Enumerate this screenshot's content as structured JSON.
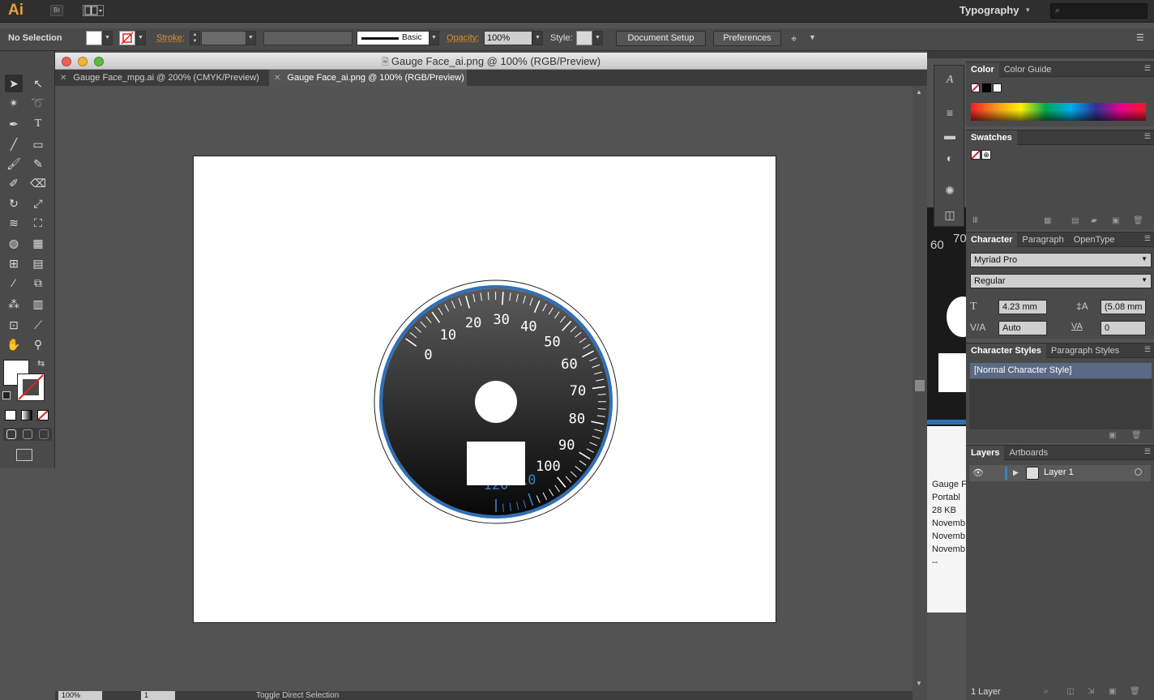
{
  "app": {
    "logo": "Ai",
    "bridge": "Br",
    "workspace": "Typography"
  },
  "control": {
    "selection": "No Selection",
    "stroke_label": "Stroke:",
    "brush": "Basic",
    "opacity_label": "Opacity:",
    "opacity_value": "100%",
    "style_label": "Style:",
    "document_setup": "Document Setup",
    "preferences": "Preferences"
  },
  "document": {
    "title": "Gauge Face_ai.png @ 100% (RGB/Preview)",
    "tabs": [
      {
        "label": "Gauge Face_mpg.ai @ 200% (CMYK/Preview)",
        "active": false
      },
      {
        "label": "Gauge Face_ai.png @ 100% (RGB/Preview)",
        "active": true
      }
    ],
    "zoom": "100%",
    "artboard_num": "1",
    "status": "Toggle Direct Selection"
  },
  "gauge": {
    "labels": [
      "0",
      "10",
      "20",
      "30",
      "40",
      "50",
      "60",
      "70",
      "80",
      "90",
      "100",
      "110",
      "120"
    ],
    "highlight_from": "110",
    "colors": {
      "ring": "#2f6fb7",
      "face_top": "#5a5a5a",
      "face_bottom": "#080808",
      "warn": "#3d7fc8"
    }
  },
  "behind_window": {
    "labels": [
      "60",
      "70"
    ],
    "info": [
      "Gauge F",
      "Portabl",
      "28 KB",
      "Novemb",
      "Novemb",
      "Novemb",
      "--"
    ]
  },
  "panels": {
    "color": {
      "tabs": [
        "Color",
        "Color Guide"
      ]
    },
    "swatches": {
      "title": "Swatches"
    },
    "character": {
      "tabs": [
        "Character",
        "Paragraph",
        "OpenType"
      ],
      "font": "Myriad Pro",
      "style": "Regular",
      "size": "4.23 mm",
      "leading": "(5.08 mm",
      "kerning": "Auto",
      "tracking": "0"
    },
    "char_styles": {
      "tabs": [
        "Character Styles",
        "Paragraph Styles"
      ],
      "items": [
        "[Normal Character Style]"
      ]
    },
    "layers": {
      "tabs": [
        "Layers",
        "Artboards"
      ],
      "items": [
        "Layer 1"
      ],
      "count": "1 Layer"
    }
  }
}
